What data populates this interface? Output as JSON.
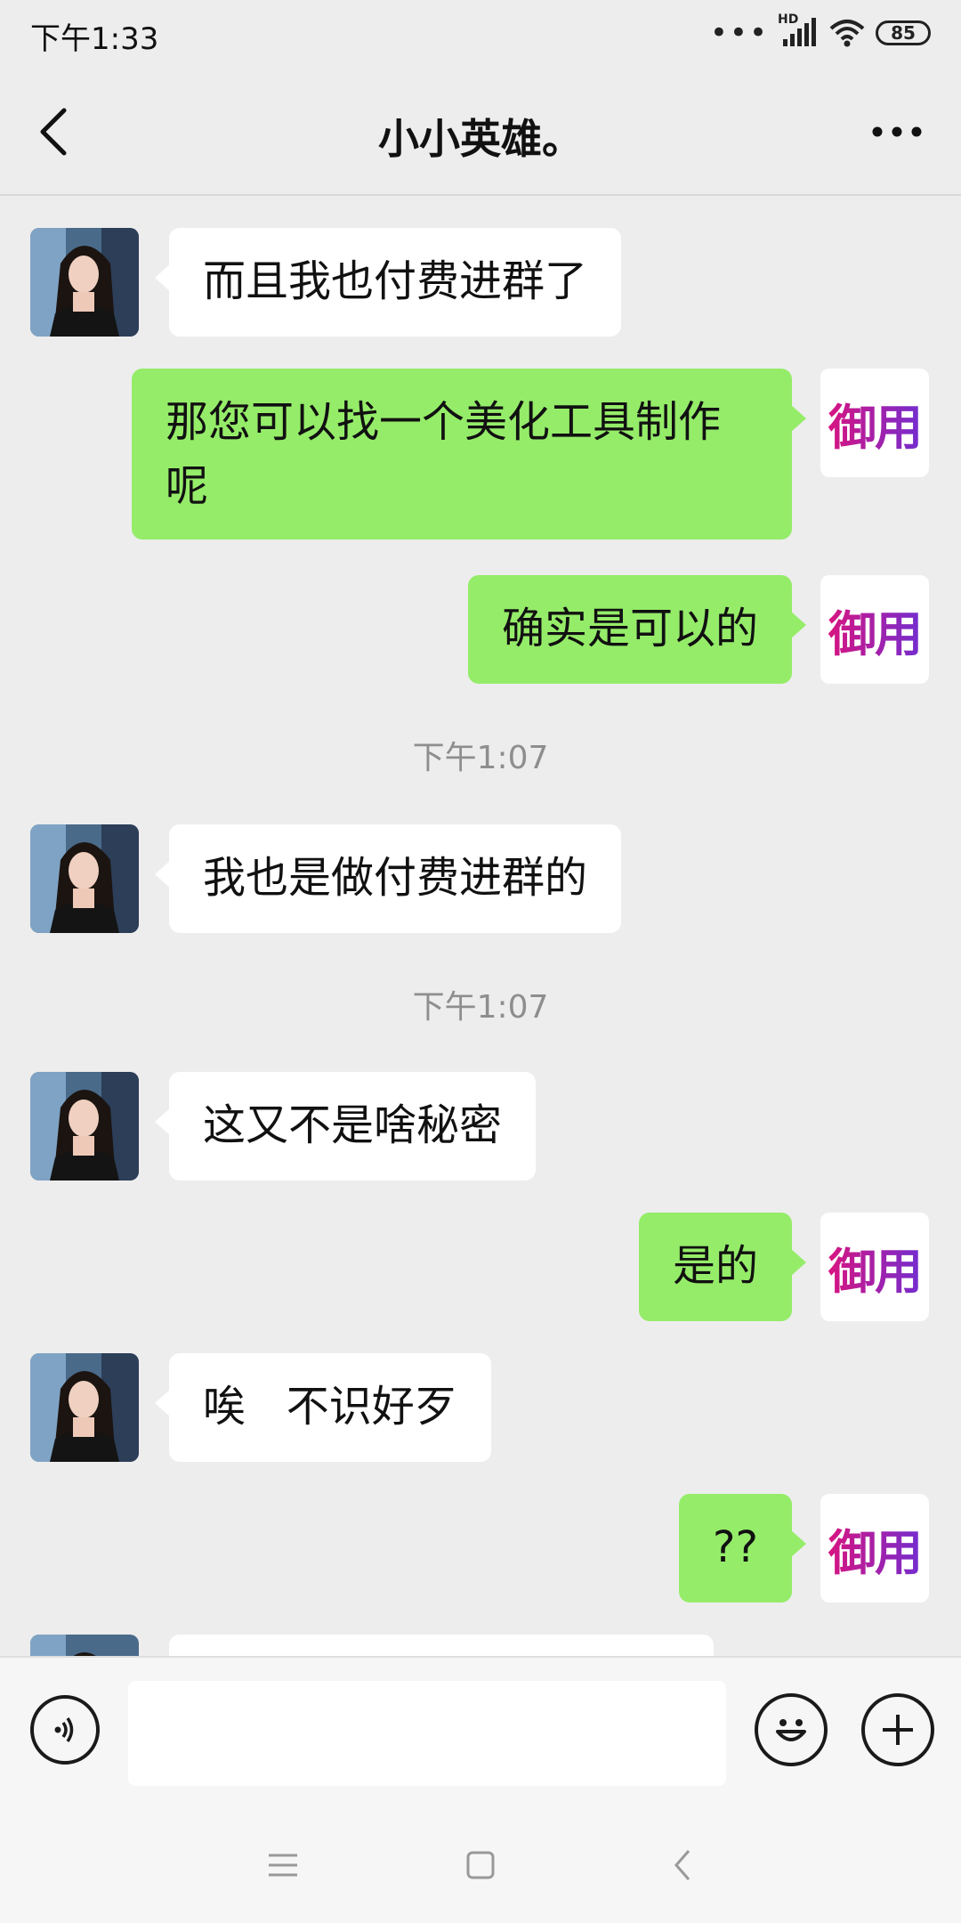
{
  "status_bar": {
    "time": "下午1:33",
    "network": "HD",
    "battery": "85"
  },
  "header": {
    "title": "小小英雄。"
  },
  "messages": [
    {
      "type": "incoming",
      "text": "而且我也付费进群了"
    },
    {
      "type": "outgoing",
      "text": "那您可以找一个美化工具制作呢",
      "avatar_text": "御用"
    },
    {
      "type": "outgoing",
      "text": "确实是可以的",
      "avatar_text": "御用"
    },
    {
      "type": "timestamp",
      "text": "下午1:07"
    },
    {
      "type": "incoming",
      "text": "我也是做付费进群的"
    },
    {
      "type": "timestamp",
      "text": "下午1:07"
    },
    {
      "type": "incoming",
      "text": "这又不是啥秘密"
    },
    {
      "type": "outgoing",
      "text": "是的",
      "avatar_text": "御用"
    },
    {
      "type": "incoming",
      "text": "唉   不识好歹"
    },
    {
      "type": "outgoing",
      "text": "??",
      "avatar_text": "御用"
    }
  ],
  "input_bar": {
    "icons": [
      "voice-icon",
      "emoji-icon",
      "plus-icon"
    ],
    "value": ""
  },
  "nav_bar": {
    "icons": [
      "menu-icon",
      "home-icon",
      "back-icon"
    ]
  },
  "colors": {
    "background": "#ededed",
    "outgoing_bubble": "#95ec69",
    "incoming_bubble": "#ffffff",
    "badge_start": "#e0127a",
    "badge_end": "#6a2fd6"
  }
}
